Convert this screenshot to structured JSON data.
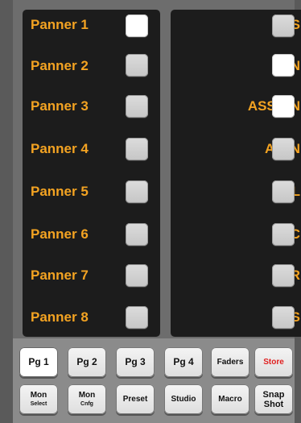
{
  "left_panel": {
    "rows": [
      {
        "label": "Panner 1",
        "active": true
      },
      {
        "label": "Panner 2",
        "active": false
      },
      {
        "label": "Panner 3",
        "active": false
      },
      {
        "label": "Panner 4",
        "active": false
      },
      {
        "label": "Panner 5",
        "active": false
      },
      {
        "label": "Panner 6",
        "active": false
      },
      {
        "label": "Panner 7",
        "active": false
      },
      {
        "label": "Panner 8",
        "active": false
      }
    ]
  },
  "right_panel": {
    "rows": [
      {
        "label": "BUS",
        "active": false
      },
      {
        "label": "PAN",
        "active": true
      },
      {
        "label": "ASSIGN",
        "active": true
      },
      {
        "label": "ATTN",
        "active": false
      },
      {
        "label": "L",
        "active": false
      },
      {
        "label": "C",
        "active": false
      },
      {
        "label": "R",
        "active": false
      },
      {
        "label": "S",
        "active": false
      }
    ]
  },
  "bottom_keys": {
    "row1": [
      {
        "label": "Pg 1",
        "selected": true
      },
      {
        "label": "Pg 2"
      },
      {
        "label": "Pg 3"
      },
      {
        "label": "Pg 4"
      },
      {
        "label": "Faders"
      },
      {
        "label": "Store",
        "color": "#e02020"
      }
    ],
    "row2": [
      {
        "label": "Mon",
        "sublabel": "Select"
      },
      {
        "label": "Mon",
        "sublabel": "Cnfg"
      },
      {
        "label": "Preset"
      },
      {
        "label": "Studio"
      },
      {
        "label": "Macro"
      },
      {
        "label": "Snap",
        "sublabel": "Shot"
      }
    ]
  },
  "colors": {
    "label_text": "#f3a322",
    "panel_bg": "#1c1c1c",
    "store_text": "#e02020"
  }
}
